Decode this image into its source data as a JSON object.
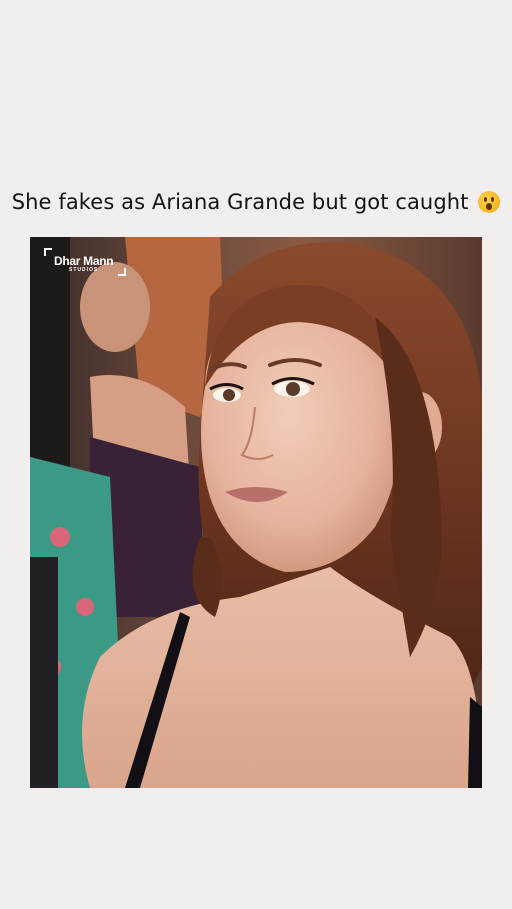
{
  "post": {
    "caption": "She fakes as Ariana Grande but got caught",
    "caption_emoji": "face-with-open-mouth-emoji"
  },
  "logo": {
    "name": "Dhar Mann",
    "subtitle": "STUDIOS"
  },
  "colors": {
    "background": "#f3eeee",
    "text": "#141414",
    "logo": "#ffffff"
  }
}
